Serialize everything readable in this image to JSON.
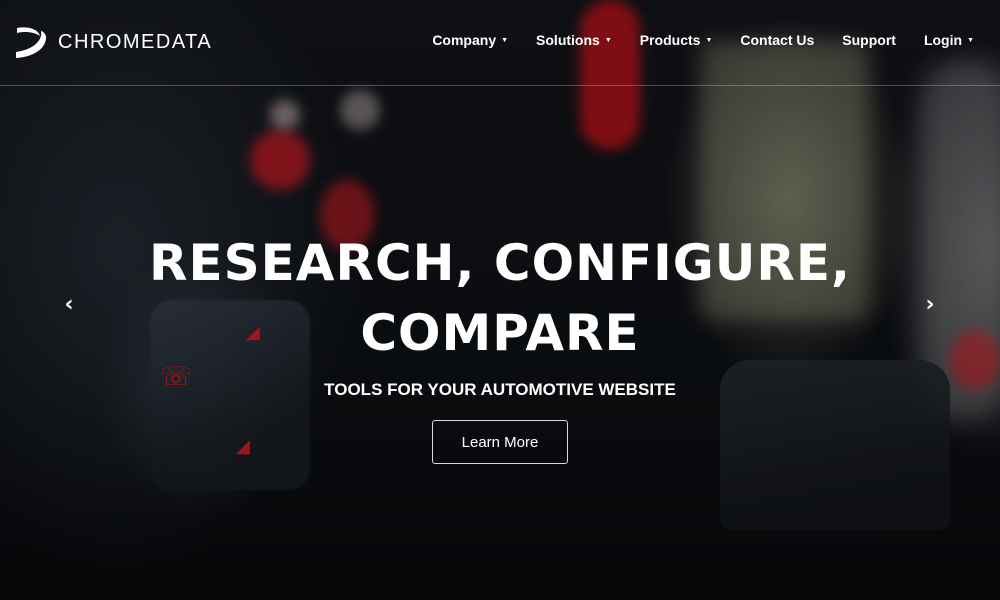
{
  "brand": {
    "name": "CHROMEDATA",
    "logo_icon": "chromedata-swoosh-logo"
  },
  "nav": {
    "items": [
      {
        "label": "Company",
        "has_dropdown": true
      },
      {
        "label": "Solutions",
        "has_dropdown": true
      },
      {
        "label": "Products",
        "has_dropdown": true
      },
      {
        "label": "Contact Us",
        "has_dropdown": false
      },
      {
        "label": "Support",
        "has_dropdown": false
      },
      {
        "label": "Login",
        "has_dropdown": true
      }
    ],
    "dropdown_glyph": "▼"
  },
  "hero": {
    "headline_line1": "RESEARCH, CONFIGURE,",
    "headline_line2": "COMPARE",
    "subline": "TOOLS FOR YOUR AUTOMOTIVE WEBSITE",
    "cta_label": "Learn More",
    "prev_icon": "‹",
    "next_icon": "›"
  },
  "colors": {
    "text": "#ffffff",
    "accent_red": "#e01f2a"
  }
}
